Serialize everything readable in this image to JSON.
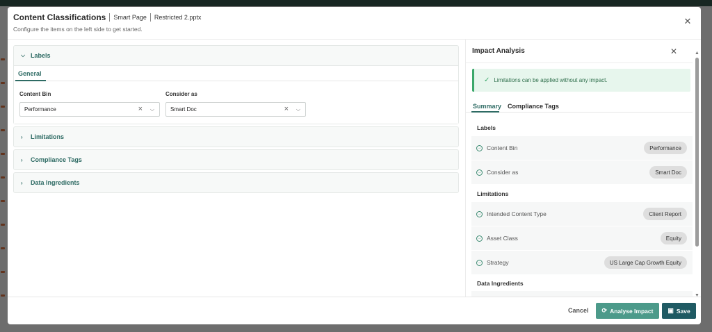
{
  "modal": {
    "title": "Content Classifications",
    "crumb_page": "Smart Page",
    "crumb_file": "Restricted 2.pptx",
    "subtitle": "Configure the items on the left side to get started.",
    "close_icon": "close-icon"
  },
  "left": {
    "sections": {
      "labels": "Labels",
      "limitations": "Limitations",
      "compliance_tags": "Compliance Tags",
      "data_ingredients": "Data Ingredients"
    },
    "general_tab": "General",
    "content_bin": {
      "label": "Content Bin",
      "value": "Performance"
    },
    "consider_as": {
      "label": "Consider as",
      "value": "Smart Doc"
    }
  },
  "impact": {
    "title": "Impact Analysis",
    "alert": "Limitations can be applied without any impact.",
    "tabs": {
      "summary": "Summary",
      "compliance": "Compliance Tags"
    },
    "groups": {
      "labels": "Labels",
      "limitations": "Limitations",
      "data_ingredients": "Data Ingredients"
    },
    "label_rows": [
      {
        "label": "Content Bin",
        "value": "Performance"
      },
      {
        "label": "Consider as",
        "value": "Smart Doc"
      }
    ],
    "limitation_rows": [
      {
        "label": "Intended Content Type",
        "value": "Client Report"
      },
      {
        "label": "Asset Class",
        "value": "Equity"
      },
      {
        "label": "Strategy",
        "value": "US Large Cap Growth Equity"
      }
    ]
  },
  "footer": {
    "cancel": "Cancel",
    "analyse": "Analyse Impact",
    "save": "Save"
  },
  "colors": {
    "accent": "#2e6b64",
    "analyse_button": "#4c9a8a",
    "save_button": "#1f5a63",
    "success": "#3ca86b"
  }
}
